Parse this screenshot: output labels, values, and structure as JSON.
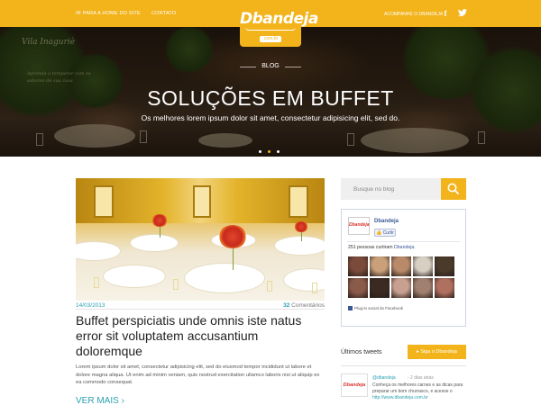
{
  "topbar": {
    "nav_home": "Ir para a home do site",
    "nav_contact": "Contato",
    "follow_label": "Acompanhe o Dbandeja",
    "social_facebook_icon": "f",
    "social_twitter_icon": "t"
  },
  "logo": {
    "word": "Dbandeja",
    "sub": ".com.br"
  },
  "hero": {
    "tag": "Blog",
    "title": "Soluções em Buffet",
    "subtitle": "Os melhores lorem ipsum dolor sit amet, consectetur adipisicing elit, sed do.",
    "cursive": "Vila Inaguriè",
    "cursive_small": "Aprenda a temperar com os sabores de sua casa",
    "slides": 3,
    "active_slide": 1
  },
  "post": {
    "date": "14/03/2013",
    "comments_count": "32",
    "comments_label": "Comentários",
    "title": "Buffet perspiciatis unde omnis iste natus error sit voluptatem accusantium doloremque",
    "excerpt": "Lorem ipsum dolor sit amet, consectetur adipisicing elit, sed do eiusmod tempor incididunt ut labore et dolore magna aliqua. Ut enim ad minim veniam, quis nostrud exercitation ullamco laboris nisi ut aliquip ex ea commodo consequat.",
    "read_more": "Ver mais",
    "read_more_icon": "›"
  },
  "sidebar": {
    "search_placeholder": "Busque no blog",
    "facebook": {
      "page_name": "Dbandeja",
      "logo_text": "Dbandeja",
      "like_button": "Curtir",
      "count_prefix": "251 pessoas curtiram",
      "count_page": "Dbandeja.",
      "plugin_label": "Plug-in social do Facebook",
      "face_colors": [
        "#7a4a3a",
        "#c9a07a",
        "#b88a6a",
        "#d6cfc2",
        "#4a3a2a",
        "#8a5a4a",
        "#3a2a22",
        "#c8a090",
        "#a08070",
        "#b07060"
      ]
    },
    "tweets": {
      "heading": "Últimos tweets",
      "follow_button": "Siga o Dbandeja",
      "user": "@dbandeja",
      "time": "- 2 dias atrás",
      "text": "Conheça os melhores carnes e as dicas para preparar um bom churrasco, e acesse o",
      "link": "http://www.dbandeja.com.br",
      "logo_text": "Dbandeja"
    }
  },
  "colors": {
    "accent": "#f2b31b",
    "link": "#2aa0b0",
    "facebook": "#3b5998"
  }
}
